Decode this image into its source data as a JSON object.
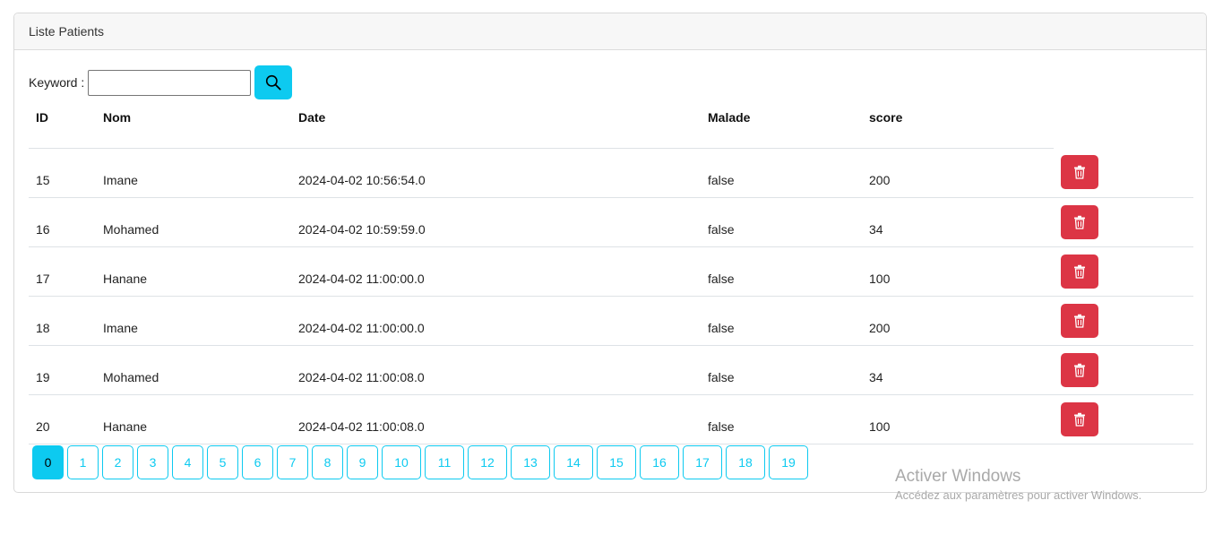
{
  "card": {
    "title": "Liste Patients"
  },
  "search": {
    "label": "Keyword :",
    "value": "",
    "placeholder": "",
    "button_icon": "search-icon"
  },
  "table": {
    "headers": [
      "ID",
      "Nom",
      "Date",
      "Malade",
      "score"
    ],
    "rows": [
      {
        "id": "15",
        "nom": "Imane",
        "date": "2024-04-02 10:56:54.0",
        "malade": "false",
        "score": "200"
      },
      {
        "id": "16",
        "nom": "Mohamed",
        "date": "2024-04-02 10:59:59.0",
        "malade": "false",
        "score": "34"
      },
      {
        "id": "17",
        "nom": "Hanane",
        "date": "2024-04-02 11:00:00.0",
        "malade": "false",
        "score": "100"
      },
      {
        "id": "18",
        "nom": "Imane",
        "date": "2024-04-02 11:00:00.0",
        "malade": "false",
        "score": "200"
      },
      {
        "id": "19",
        "nom": "Mohamed",
        "date": "2024-04-02 11:00:08.0",
        "malade": "false",
        "score": "34"
      },
      {
        "id": "20",
        "nom": "Hanane",
        "date": "2024-04-02 11:00:08.0",
        "malade": "false",
        "score": "100"
      }
    ],
    "delete_icon": "trash-icon"
  },
  "pagination": {
    "pages": [
      "0",
      "1",
      "2",
      "3",
      "4",
      "5",
      "6",
      "7",
      "8",
      "9",
      "10",
      "11",
      "12",
      "13",
      "14",
      "15",
      "16",
      "17",
      "18",
      "19"
    ],
    "current": "0"
  },
  "watermark": {
    "title": "Activer Windows",
    "subtitle": "Accédez aux paramètres pour activer Windows."
  },
  "colors": {
    "accent": "#0dcaf0",
    "danger": "#dc3545",
    "header_bg": "#f7f7f7"
  }
}
